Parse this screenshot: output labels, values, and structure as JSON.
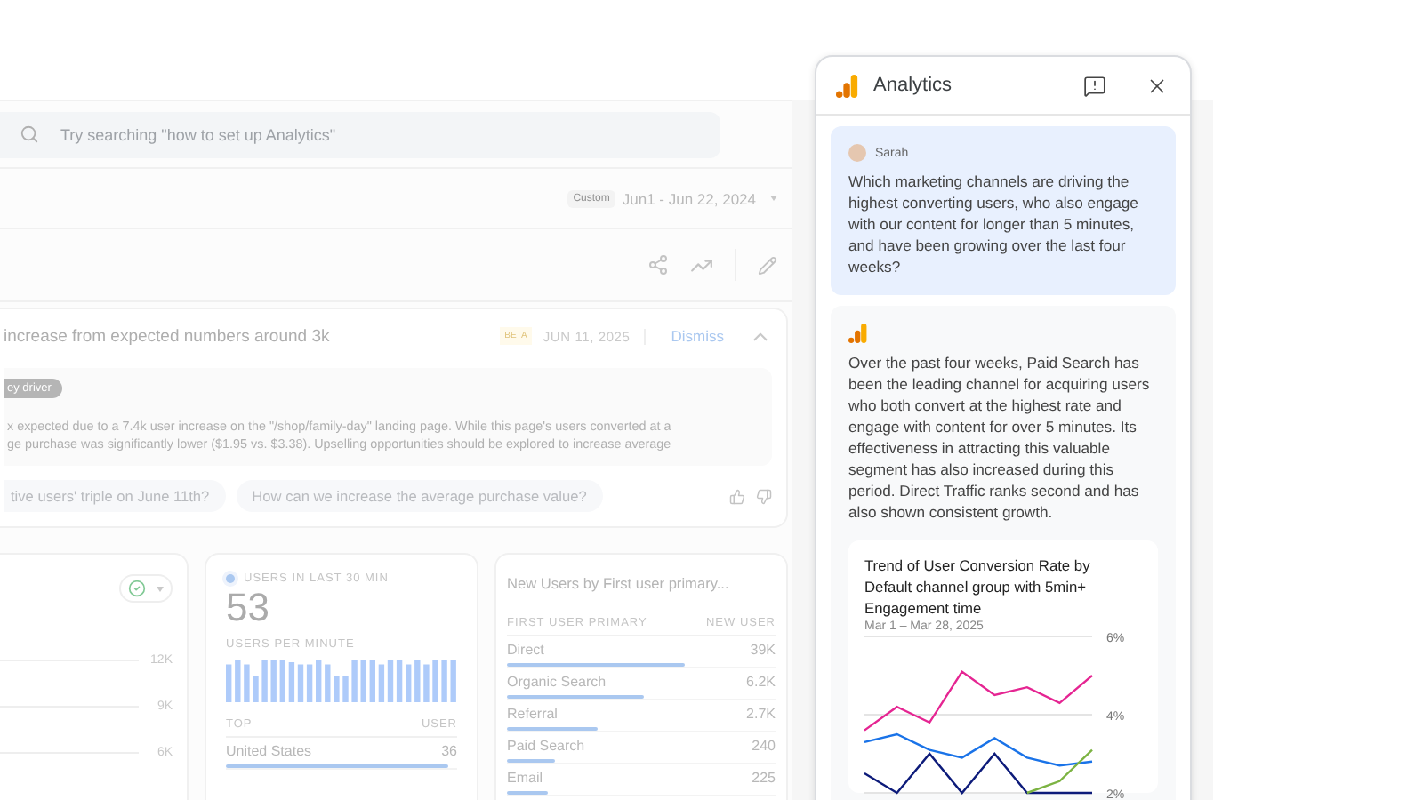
{
  "search": {
    "placeholder": "Try searching \"how to set up Analytics\""
  },
  "date_range": {
    "badge": "Custom",
    "text": "Jun1 - Jun 22, 2024"
  },
  "insight": {
    "title": "increase from expected numbers around 3k",
    "badge": "BETA",
    "date": "JUN 11, 2025",
    "action": "Dismiss",
    "expanded": true,
    "tag": "ey driver",
    "lines": [
      "x expected due to a 7.4k user increase on the \"/shop/family-day\" landing page. While this page's users converted at a",
      "ge purchase was significantly lower ($1.95 vs. $3.38).  Upselling opportunities should be explored to increase average"
    ],
    "suggestions": [
      "tive users' triple on June 11th?",
      "How can we increase the average purchase value?"
    ]
  },
  "trend_card": {
    "checked": true,
    "axis_labels": [
      "12K",
      "9K",
      "6K"
    ]
  },
  "realtime": {
    "label": "USERS IN LAST 30 MIN",
    "value": "53",
    "sub_label": "USERS PER MINUTE",
    "columns": [
      "TOP",
      "USER"
    ],
    "rows": [
      {
        "name": "United States",
        "value": "36",
        "level": 0.96
      }
    ]
  },
  "channels": {
    "title": "New Users by First user primary...",
    "columns": [
      "FIRST USER PRIMARY",
      "NEW USER"
    ],
    "rows": [
      {
        "name": "Direct",
        "value": "39K",
        "level": 0.66
      },
      {
        "name": "Organic Search",
        "value": "6.2K",
        "level": 0.51
      },
      {
        "name": "Referral",
        "value": "2.7K",
        "level": 0.34
      },
      {
        "name": "Paid Search",
        "value": "240",
        "level": 0.18
      },
      {
        "name": "Email",
        "value": "225",
        "level": 0.15
      }
    ]
  },
  "panel": {
    "title": "Analytics",
    "messages": [
      {
        "kind": "user",
        "author": "Sarah",
        "text": "Which marketing channels are driving the highest converting users, who also engage with our content for longer than 5 minutes, and have been growing over the last four weeks?"
      },
      {
        "kind": "assistant",
        "text": "Over the past four weeks, Paid Search has been the leading channel for acquiring users who both convert at the highest rate and engage with content for over 5 minutes. Its effectiveness in attracting this valuable segment has also increased during this period. Direct Traffic ranks second and has also shown consistent growth.",
        "chart": {
          "title": "Trend of User Conversion Rate by Default channel group with 5min+ Engagement time",
          "subtitle": "Mar 1 – Mar 28, 2025",
          "chart_data": {
            "type": "line",
            "grid": true,
            "ylim": [
              2,
              6
            ],
            "yticks": [
              {
                "value": 6,
                "label": "6%"
              },
              {
                "value": 4,
                "label": "4%"
              },
              {
                "value": 2,
                "label": "2%"
              }
            ],
            "series": [
              {
                "color": "#e52592",
                "values": [
                  3.6,
                  4.2,
                  3.8,
                  5.1,
                  4.5,
                  4.7,
                  4.3,
                  5.0
                ]
              },
              {
                "color": "#1a73e8",
                "values": [
                  3.3,
                  3.5,
                  3.1,
                  2.9,
                  3.4,
                  2.9,
                  2.7,
                  2.8
                ]
              },
              {
                "color": "#0d1b7a",
                "values": [
                  2.5,
                  2.0,
                  3.0,
                  2.0,
                  3.0,
                  2.0,
                  2.0,
                  2.0
                ]
              },
              {
                "color": "#7cb342",
                "values": [
                  null,
                  null,
                  null,
                  null,
                  null,
                  2.0,
                  2.3,
                  3.1
                ]
              }
            ]
          }
        }
      }
    ]
  }
}
